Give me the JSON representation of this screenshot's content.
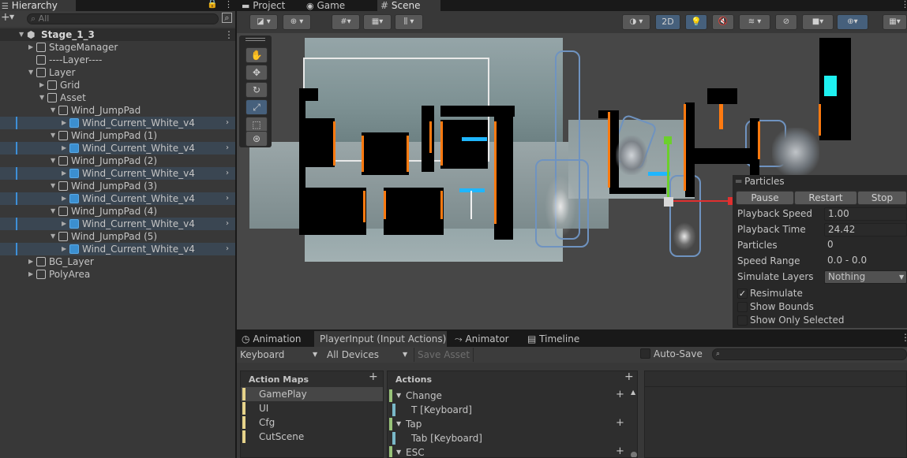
{
  "hierarchy": {
    "tab_label": "Hierarchy",
    "search_placeholder": "All",
    "scene_name": "Stage_1_3",
    "items": [
      {
        "label": "StageManager"
      },
      {
        "label": "----Layer----"
      },
      {
        "label": "Layer"
      },
      {
        "label": "Grid"
      },
      {
        "label": "Asset"
      },
      {
        "label": "Wind_JumpPad"
      },
      {
        "label": "Wind_Current_White_v4"
      },
      {
        "label": "Wind_JumpPad (1)"
      },
      {
        "label": "Wind_Current_White_v4"
      },
      {
        "label": "Wind_JumpPad (2)"
      },
      {
        "label": "Wind_Current_White_v4"
      },
      {
        "label": "Wind_JumpPad (3)"
      },
      {
        "label": "Wind_Current_White_v4"
      },
      {
        "label": "Wind_JumpPad (4)"
      },
      {
        "label": "Wind_Current_White_v4"
      },
      {
        "label": "Wind_JumpPad (5)"
      },
      {
        "label": "Wind_Current_White_v4"
      },
      {
        "label": "BG_Layer"
      },
      {
        "label": "PolyArea"
      }
    ]
  },
  "top_tabs": {
    "project": "Project",
    "game": "Game",
    "scene": "Scene"
  },
  "scene_toolbar": {
    "mode_2d": "2D"
  },
  "particles": {
    "title": "Particles",
    "pause": "Pause",
    "restart": "Restart",
    "stop": "Stop",
    "fields": [
      {
        "label": "Playback Speed",
        "value": "1.00"
      },
      {
        "label": "Playback Time",
        "value": "24.42"
      },
      {
        "label": "Particles",
        "value": "0"
      },
      {
        "label": "Speed Range",
        "value": "0.0 - 0.0"
      },
      {
        "label": "Simulate Layers",
        "value": "Nothing"
      }
    ],
    "resimulate": "Resimulate",
    "show_bounds": "Show Bounds",
    "show_only_selected": "Show Only Selected"
  },
  "bottom_tabs": {
    "animation": "Animation",
    "player_input": "PlayerInput (Input Actions)",
    "animator": "Animator",
    "timeline": "Timeline"
  },
  "input_toolbar": {
    "scheme": "Keyboard",
    "devices": "All Devices",
    "save_asset": "Save Asset",
    "auto_save": "Auto-Save"
  },
  "action_maps": {
    "header": "Action Maps",
    "items": [
      "GamePlay",
      "UI",
      "Cfg",
      "CutScene"
    ]
  },
  "actions": {
    "header": "Actions",
    "items": [
      {
        "label": "Change",
        "kind": "action"
      },
      {
        "label": "T [Keyboard]",
        "kind": "binding"
      },
      {
        "label": "Tap",
        "kind": "action"
      },
      {
        "label": "Tab [Keyboard]",
        "kind": "binding"
      },
      {
        "label": "ESC",
        "kind": "action"
      }
    ]
  },
  "colors": {
    "selection": "#2c5d87",
    "accent": "#ff7a10",
    "map_action": "#98c379"
  }
}
